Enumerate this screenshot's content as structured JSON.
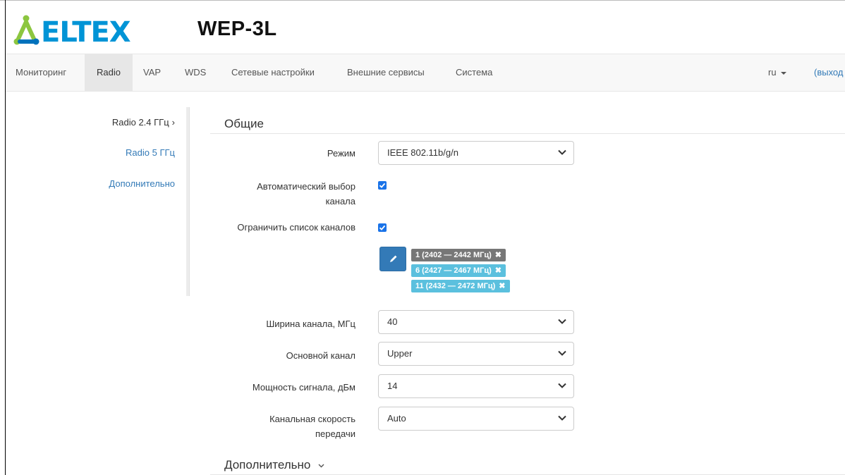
{
  "header": {
    "brand": "ELTEX",
    "device": "WEP-3L",
    "brand_colors": {
      "icon_green": "#8cc63f",
      "icon_blue": "#0072bc",
      "text_blue": "#0094d6"
    }
  },
  "nav": {
    "items": [
      {
        "label": "Мониторинг"
      },
      {
        "label": "Radio",
        "active": true
      },
      {
        "label": "VAP"
      },
      {
        "label": "WDS"
      },
      {
        "label": "Сетевые настройки"
      },
      {
        "label": "Внешние сервисы"
      },
      {
        "label": "Система"
      }
    ],
    "lang": "ru",
    "logout": "(выход"
  },
  "sidebar": {
    "items": [
      {
        "label": "Radio 2.4 ГГц",
        "suffix": "›",
        "current": true
      },
      {
        "label": "Radio 5 ГГц"
      },
      {
        "label": "Дополнительно"
      }
    ]
  },
  "general": {
    "title": "Общие",
    "mode": {
      "label": "Режим",
      "value": "IEEE 802.11b/g/n"
    },
    "auto_channel": {
      "label_line1": "Автоматический выбор",
      "label_line2": "канала",
      "checked": true
    },
    "limit_channels": {
      "label": "Ограничить список каналов",
      "checked": true
    },
    "channels": [
      {
        "label": "1 (2402 — 2442 МГц)",
        "color": "#777777"
      },
      {
        "label": "6 (2427 — 2467 МГц)",
        "color": "#5bc0de"
      },
      {
        "label": "11 (2432 — 2472 МГц)",
        "color": "#5bc0de"
      }
    ],
    "tag_remove": "✖",
    "bandwidth": {
      "label": "Ширина канала, МГц",
      "value": "40"
    },
    "primary_channel": {
      "label": "Основной канал",
      "value": "Upper"
    },
    "power": {
      "label": "Мощность сигнала, дБм",
      "value": "14"
    },
    "rate": {
      "label_line1": "Канальная скорость",
      "label_line2": "передачи",
      "value": "Auto"
    }
  },
  "advanced": {
    "title": "Дополнительно"
  },
  "colors": {
    "accent": "#337ab7",
    "checkbox": "#1a73e8",
    "nav_active_bg": "#e7e7e7"
  }
}
